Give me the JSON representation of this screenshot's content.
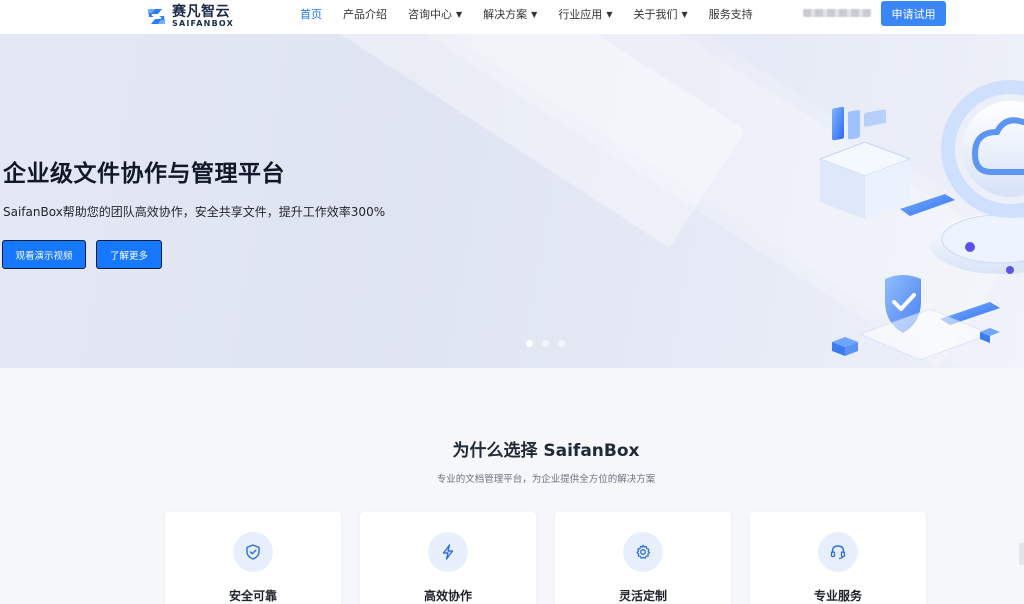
{
  "header": {
    "logo_cn": "赛凡智云",
    "logo_en": "SAIFANBOX",
    "nav": [
      {
        "label": "首页",
        "active": true,
        "dropdown": false
      },
      {
        "label": "产品介绍",
        "active": false,
        "dropdown": false
      },
      {
        "label": "咨询中心",
        "active": false,
        "dropdown": true
      },
      {
        "label": "解决方案",
        "active": false,
        "dropdown": true
      },
      {
        "label": "行业应用",
        "active": false,
        "dropdown": true
      },
      {
        "label": "关于我们",
        "active": false,
        "dropdown": true
      },
      {
        "label": "服务支持",
        "active": false,
        "dropdown": false
      }
    ],
    "caret": "▼",
    "apply_label": "申请试用"
  },
  "hero": {
    "title": "企业级文件协作与管理平台",
    "subtitle": "SaifanBox帮助您的团队高效协作，安全共享文件，提升工作效率300%",
    "btn_video": "观看演示视频",
    "btn_more": "了解更多",
    "slides": 3,
    "active_slide": 0
  },
  "why": {
    "title": "为什么选择 SaifanBox",
    "subtitle": "专业的文档管理平台，为企业提供全方位的解决方案",
    "cards": [
      {
        "title": "安全可靠",
        "icon": "shield-check-icon"
      },
      {
        "title": "高效协作",
        "icon": "lightning-icon"
      },
      {
        "title": "灵活定制",
        "icon": "gear-icon"
      },
      {
        "title": "专业服务",
        "icon": "headset-icon"
      }
    ]
  },
  "colors": {
    "primary": "#1677ff",
    "apply_button": "#3a86f5",
    "icon_bg": "#e8effc",
    "icon_stroke": "#2f6fe0"
  }
}
